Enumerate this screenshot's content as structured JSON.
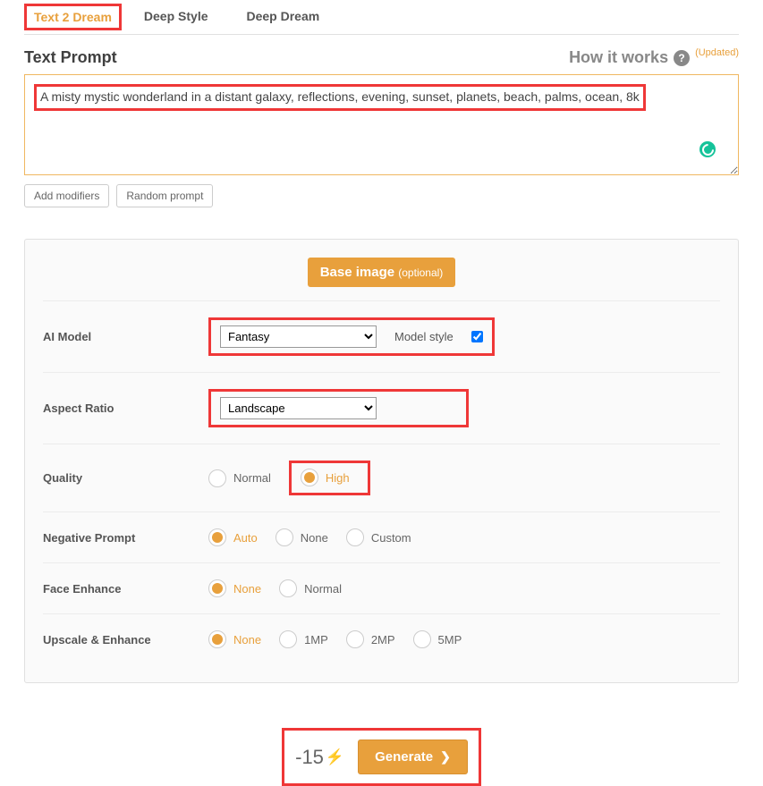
{
  "tabs": {
    "text2dream": "Text 2 Dream",
    "deepstyle": "Deep Style",
    "deepdream": "Deep Dream"
  },
  "prompt": {
    "title": "Text Prompt",
    "how_it_works": "How it works",
    "updated": "(Updated)",
    "value": "A misty mystic wonderland in a distant galaxy, reflections, evening, sunset, planets, beach, palms, ocean, 8k",
    "add_modifiers": "Add modifiers",
    "random": "Random prompt"
  },
  "settings": {
    "base_image": "Base image",
    "base_image_optional": "(optional)",
    "ai_model": {
      "label": "AI Model",
      "value": "Fantasy",
      "model_style_label": "Model style",
      "model_style_checked": true
    },
    "aspect": {
      "label": "Aspect Ratio",
      "value": "Landscape"
    },
    "quality": {
      "label": "Quality",
      "options": {
        "normal": "Normal",
        "high": "High"
      },
      "selected": "high"
    },
    "negative": {
      "label": "Negative Prompt",
      "options": {
        "auto": "Auto",
        "none": "None",
        "custom": "Custom"
      },
      "selected": "auto"
    },
    "face": {
      "label": "Face Enhance",
      "options": {
        "none": "None",
        "normal": "Normal"
      },
      "selected": "none"
    },
    "upscale": {
      "label": "Upscale & Enhance",
      "options": {
        "none": "None",
        "mp1": "1MP",
        "mp2": "2MP",
        "mp5": "5MP"
      },
      "selected": "none"
    }
  },
  "generate": {
    "cost": "-15",
    "label": "Generate"
  }
}
